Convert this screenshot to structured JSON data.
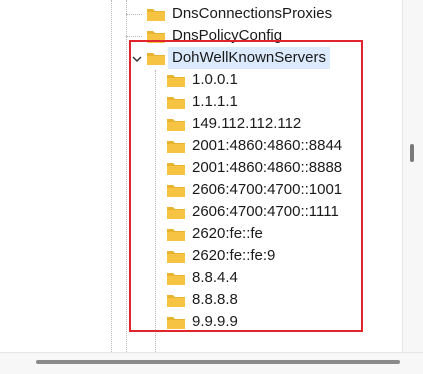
{
  "registry_tree": {
    "siblings_above": [
      {
        "label": "DnsConnectionsProxies"
      },
      {
        "label": "DnsPolicyConfig"
      }
    ],
    "expanded_key": {
      "label": "DohWellKnownServers",
      "state": "expanded",
      "selected": true
    },
    "children": [
      {
        "label": "1.0.0.1"
      },
      {
        "label": "1.1.1.1"
      },
      {
        "label": "149.112.112.112"
      },
      {
        "label": "2001:4860:4860::8844"
      },
      {
        "label": "2001:4860:4860::8888"
      },
      {
        "label": "2606:4700:4700::1001"
      },
      {
        "label": "2606:4700:4700::1111"
      },
      {
        "label": "2620:fe::fe"
      },
      {
        "label": "2620:fe::fe:9"
      },
      {
        "label": "8.8.4.4"
      },
      {
        "label": "8.8.8.8"
      },
      {
        "label": "9.9.9.9"
      }
    ]
  },
  "icons": {
    "folder": "folder-icon",
    "expand": "chevron-down-icon"
  },
  "colors": {
    "highlight_box": "#e0252c",
    "folder": "#f6c343",
    "selection": "#dbeafc"
  }
}
